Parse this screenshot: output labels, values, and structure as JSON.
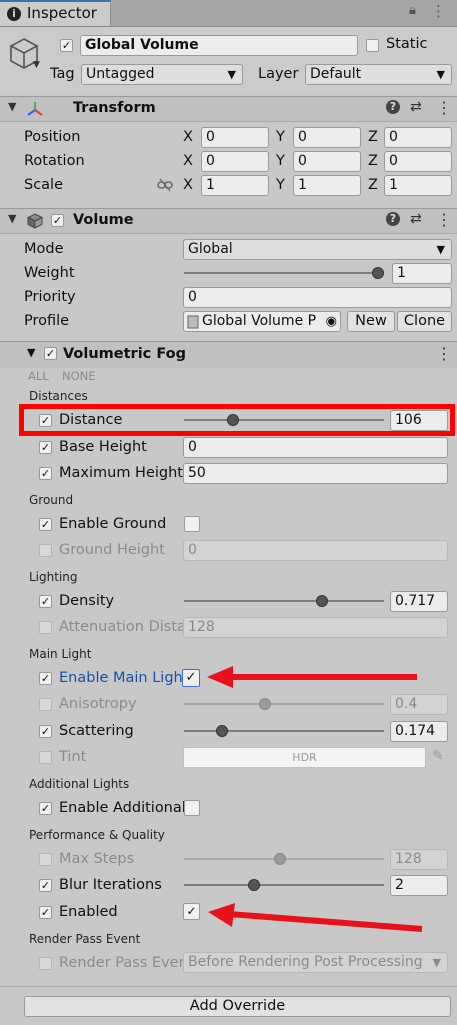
{
  "tab": {
    "title": "Inspector"
  },
  "object": {
    "name": "Global Volume",
    "static_label": "Static",
    "tag_label": "Tag",
    "tag_value": "Untagged",
    "layer_label": "Layer",
    "layer_value": "Default"
  },
  "transform": {
    "title": "Transform",
    "rows": [
      {
        "label": "Position",
        "x": "0",
        "y": "0",
        "z": "0"
      },
      {
        "label": "Rotation",
        "x": "0",
        "y": "0",
        "z": "0"
      },
      {
        "label": "Scale",
        "x": "1",
        "y": "1",
        "z": "1"
      }
    ],
    "axes": [
      "X",
      "Y",
      "Z"
    ]
  },
  "volume": {
    "title": "Volume",
    "mode_label": "Mode",
    "mode_value": "Global",
    "weight_label": "Weight",
    "weight_value": "1",
    "weight_fraction": 1.0,
    "priority_label": "Priority",
    "priority_value": "0",
    "profile_label": "Profile",
    "profile_value": "Global Volume P",
    "new_label": "New",
    "clone_label": "Clone"
  },
  "fog": {
    "title": "Volumetric Fog",
    "all_label": "ALL",
    "none_label": "NONE",
    "groups": {
      "distances": "Distances",
      "ground": "Ground",
      "lighting": "Lighting",
      "main_light": "Main Light",
      "additional_lights": "Additional Lights",
      "performance": "Performance & Quality",
      "render_pass": "Render Pass Event"
    },
    "distance": {
      "label": "Distance",
      "value": "106",
      "fraction": 0.23
    },
    "base_height": {
      "label": "Base Height",
      "value": "0"
    },
    "max_height": {
      "label": "Maximum Height",
      "value": "50"
    },
    "enable_ground": {
      "label": "Enable Ground"
    },
    "ground_height": {
      "label": "Ground Height",
      "value": "0"
    },
    "density": {
      "label": "Density",
      "value": "0.717",
      "fraction": 0.7
    },
    "attenuation": {
      "label": "Attenuation Dista",
      "value": "128"
    },
    "enable_main_light": {
      "label": "Enable Main Ligh"
    },
    "anisotropy": {
      "label": "Anisotropy",
      "value": "0.4",
      "fraction": 0.4
    },
    "scattering": {
      "label": "Scattering",
      "value": "0.174",
      "fraction": 0.17
    },
    "tint": {
      "label": "Tint",
      "value": "HDR"
    },
    "enable_additional": {
      "label": "Enable Additional"
    },
    "max_steps": {
      "label": "Max Steps",
      "value": "128",
      "fraction": 0.48
    },
    "blur_iterations": {
      "label": "Blur Iterations",
      "value": "2",
      "fraction": 0.34
    },
    "enabled": {
      "label": "Enabled"
    },
    "render_pass": {
      "label": "Render Pass Ever",
      "value": "Before Rendering Post Processing"
    }
  },
  "footer": {
    "add_override_label": "Add Override"
  },
  "colors": {
    "highlight": "#ff0000",
    "arrow": "#e8101a",
    "link_blue": "#1a4fa8"
  }
}
